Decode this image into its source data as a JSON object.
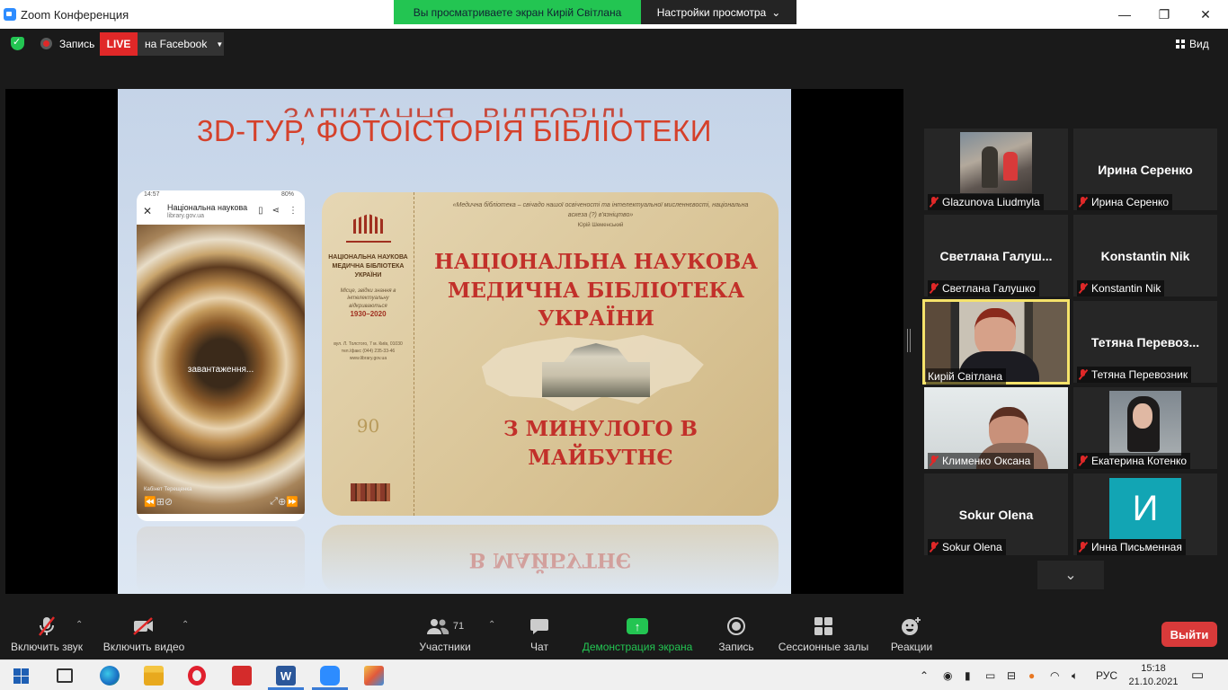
{
  "window": {
    "title": "Zoom Конференция",
    "viewing_banner": "Вы просматриваете экран Кирій Світлана",
    "view_settings": "Настройки просмотра",
    "minimize": "—",
    "restore": "❐",
    "close": "✕"
  },
  "topbar": {
    "record_label": "Запись",
    "live_label": "LIVE",
    "stream_target": "на Facebook",
    "view_label": "Вид"
  },
  "slide": {
    "ghost_title": "ЗАПИТАННЯ - ВІДПОВІДІ",
    "title": "3D-ТУР, ФОТОІСТОРІЯ БІБЛІОТЕКИ",
    "phone": {
      "time": "14:57",
      "battery": "80%",
      "page_title": "Національна наукова...",
      "page_url": "library.gov.ua",
      "loading_text": "завантаження...",
      "caption": "Кабінет Терещенка"
    },
    "banner": {
      "quote": "«Медична бібліотека – свічадо нашої освіченості та інтелектуальної мисленнєвості, національна аскеза (?) в'язніцтво»",
      "quote_author": "Юрій Шеменський",
      "org": "НАЦІОНАЛЬНА НАУКОВА МЕДИЧНА БІБЛІОТЕКА УКРАЇНИ",
      "motto": "Місце, звідки знання в інтелектуальну відкриваються",
      "years": "1930–2020",
      "address": "вул. Л. Толстого, 7 м. Київ, 01030 тел./факс (044) 235-33-46 www.library.gov.ua",
      "anniversary": "90",
      "name": "НАЦІОНАЛЬНА НАУКОВА МЕДИЧНА БІБЛІОТЕКА УКРАЇНИ",
      "tagline": "З МИНУЛОГО В МАЙБУТНЄ",
      "reflection": "В МАЙБУТНЄ"
    }
  },
  "participants": [
    {
      "name": "Glazunova Liudmyla",
      "big": "",
      "video": true
    },
    {
      "name": "Ирина Серенко",
      "big": "Ирина Серенко",
      "video": false
    },
    {
      "name": "Светлана Галушко",
      "big": "Светлана  Галуш...",
      "video": false
    },
    {
      "name": "Konstantin Nik",
      "big": "Konstantin Nik",
      "video": false
    },
    {
      "name": "Кирій Світлана",
      "big": "",
      "video": true,
      "active": true
    },
    {
      "name": "Тетяна Перевозник",
      "big": "Тетяна  Перевоз...",
      "video": false
    },
    {
      "name": "Клименко Оксана",
      "big": "",
      "video": true
    },
    {
      "name": "Екатерина Котенко",
      "big": "",
      "video": true
    },
    {
      "name": "Sokur Olena",
      "big": "Sokur Olena",
      "video": false
    },
    {
      "name": "Инна Письменная",
      "big": "",
      "video": false,
      "avatar_letter": "И",
      "avatar_color": "#12a5b4"
    }
  ],
  "toolbar": {
    "mute": "Включить звук",
    "video": "Включить видео",
    "participants": "Участники",
    "participants_count": "71",
    "chat": "Чат",
    "share": "Демонстрация экрана",
    "record": "Запись",
    "breakout": "Сессионные залы",
    "reactions": "Реакции",
    "leave": "Выйти"
  },
  "taskbar": {
    "lang": "РУС",
    "time": "15:18",
    "date": "21.10.2021"
  },
  "colors": {
    "zoom_green": "#23c552",
    "live_red": "#e02828",
    "leave_red": "#d93a3a",
    "active_speaker": "#f5e26a",
    "slide_red": "#d5412b"
  }
}
